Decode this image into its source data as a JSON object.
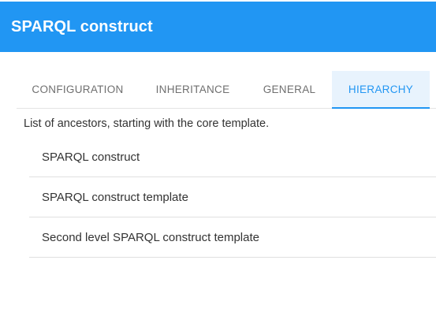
{
  "header": {
    "title": "SPARQL construct"
  },
  "tabs": [
    {
      "label": "CONFIGURATION",
      "active": false
    },
    {
      "label": "INHERITANCE",
      "active": false
    },
    {
      "label": "GENERAL",
      "active": false
    },
    {
      "label": "HIERARCHY",
      "active": true
    }
  ],
  "hierarchy": {
    "description": "List of ancestors, starting with the core template.",
    "items": [
      {
        "label": "SPARQL construct"
      },
      {
        "label": "SPARQL construct template"
      },
      {
        "label": "Second level SPARQL construct template"
      }
    ]
  },
  "colors": {
    "accent": "#2196f3",
    "active_tab_bg": "#e8f3fd"
  }
}
